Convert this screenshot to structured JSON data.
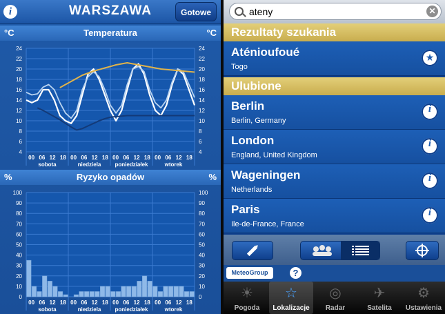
{
  "left": {
    "header": {
      "info_glyph": "i",
      "city": "WARSZAWA",
      "done_label": "Gotowe"
    },
    "temp": {
      "unit": "°C",
      "title": "Temperatura",
      "ticks": [
        "24",
        "22",
        "20",
        "18",
        "16",
        "14",
        "12",
        "10",
        "8",
        "6",
        "4"
      ],
      "hours": [
        "00",
        "06",
        "12",
        "18",
        "00",
        "06",
        "12",
        "18",
        "00",
        "06",
        "12",
        "18",
        "00",
        "06",
        "12",
        "18"
      ],
      "days": [
        "sobota",
        "niedziela",
        "poniedziałek",
        "wtorek"
      ]
    },
    "rain": {
      "unit": "%",
      "title": "Ryzyko opadów",
      "ticks": [
        "100",
        "90",
        "80",
        "70",
        "60",
        "50",
        "40",
        "30",
        "20",
        "10",
        "0"
      ],
      "hours": [
        "00",
        "06",
        "12",
        "18",
        "00",
        "06",
        "12",
        "18",
        "00",
        "06",
        "12",
        "18",
        "00",
        "06",
        "12",
        "18"
      ],
      "days": [
        "sobota",
        "niedziela",
        "poniedziałek",
        "wtorek"
      ]
    }
  },
  "chart_data": [
    {
      "type": "line",
      "title": "Temperatura",
      "ylabel": "°C",
      "ylim": [
        4,
        24
      ],
      "x": [
        "sob 00",
        "sob 03",
        "sob 06",
        "sob 09",
        "sob 12",
        "sob 15",
        "sob 18",
        "sob 21",
        "nie 00",
        "nie 03",
        "nie 06",
        "nie 09",
        "nie 12",
        "nie 15",
        "nie 18",
        "nie 21",
        "pon 00",
        "pon 03",
        "pon 06",
        "pon 09",
        "pon 12",
        "pon 15",
        "pon 18",
        "pon 21",
        "wto 00",
        "wto 03",
        "wto 06",
        "wto 09",
        "wto 12",
        "wto 15",
        "wto 18"
      ],
      "series": [
        {
          "values": [
            14,
            13.5,
            14,
            16,
            16,
            14,
            11,
            10,
            9.5,
            11,
            15,
            19,
            20,
            18,
            15,
            12,
            10,
            12,
            16,
            20,
            21,
            19,
            15,
            12,
            11,
            13,
            17,
            20,
            19,
            16,
            13
          ]
        },
        {
          "values": [
            15.5,
            15,
            15.2,
            16.5,
            17,
            16,
            13.5,
            11.5,
            10.5,
            12,
            16,
            18.5,
            19.5,
            18.5,
            16,
            13,
            11.5,
            13,
            17,
            20,
            20.5,
            19.5,
            16,
            13.5,
            12.5,
            14,
            17.5,
            20,
            19.5,
            17,
            14.5
          ]
        },
        {
          "values": [
            null,
            null,
            null,
            null,
            null,
            null,
            16.4,
            17,
            17.6,
            18.2,
            18.8,
            19.2,
            19.6,
            19.9,
            20.2,
            20.5,
            20.8,
            21,
            21.2,
            21,
            20.8,
            20.6,
            20.4,
            20.2,
            20,
            19.9,
            19.8,
            19.7,
            19.6,
            19.5,
            19.4
          ]
        },
        {
          "values": [
            null,
            null,
            12.5,
            12,
            11.4,
            10.8,
            10.2,
            9.5,
            8.8,
            8.2,
            8.5,
            9,
            9.5,
            10,
            10.4,
            10.7,
            10.8,
            10.9,
            11,
            11,
            11,
            11,
            11,
            11,
            11,
            11,
            11,
            11,
            11,
            11,
            11
          ]
        }
      ]
    },
    {
      "type": "bar",
      "title": "Ryzyko opadów",
      "ylabel": "%",
      "ylim": [
        0,
        100
      ],
      "categories": [
        "00",
        "03",
        "06",
        "09",
        "12",
        "15",
        "18",
        "21",
        "00",
        "03",
        "06",
        "09",
        "12",
        "15",
        "18",
        "21",
        "00",
        "03",
        "06",
        "09",
        "12",
        "15",
        "18",
        "21",
        "00",
        "03",
        "06",
        "09",
        "12",
        "15",
        "18",
        "21"
      ],
      "values": [
        35,
        10,
        5,
        20,
        15,
        10,
        5,
        2,
        0,
        2,
        5,
        5,
        5,
        5,
        10,
        10,
        5,
        5,
        10,
        10,
        10,
        15,
        20,
        15,
        10,
        5,
        10,
        10,
        10,
        10,
        5,
        5
      ]
    }
  ],
  "right": {
    "search": {
      "value": "ateny"
    },
    "results_header": "Rezultaty szukania",
    "results": [
      {
        "name": "Aténioufoué",
        "sub": "Togo",
        "action": "star-icon"
      }
    ],
    "favorites_header": "Ulubione",
    "favorites": [
      {
        "name": "Berlin",
        "sub": "Berlin, Germany"
      },
      {
        "name": "London",
        "sub": "England, United Kingdom"
      },
      {
        "name": "Wageningen",
        "sub": "Netherlands"
      },
      {
        "name": "Paris",
        "sub": "Ile-de-France, France"
      }
    ],
    "brand": "MeteoGroup",
    "help_glyph": "?",
    "tabs": [
      {
        "label": "Pogoda",
        "icon": "weather-icon"
      },
      {
        "label": "Lokalizacje",
        "icon": "locations-icon",
        "active": true
      },
      {
        "label": "Radar",
        "icon": "radar-icon"
      },
      {
        "label": "Satelita",
        "icon": "satellite-icon"
      },
      {
        "label": "Ustawienia",
        "icon": "settings-icon"
      }
    ]
  }
}
